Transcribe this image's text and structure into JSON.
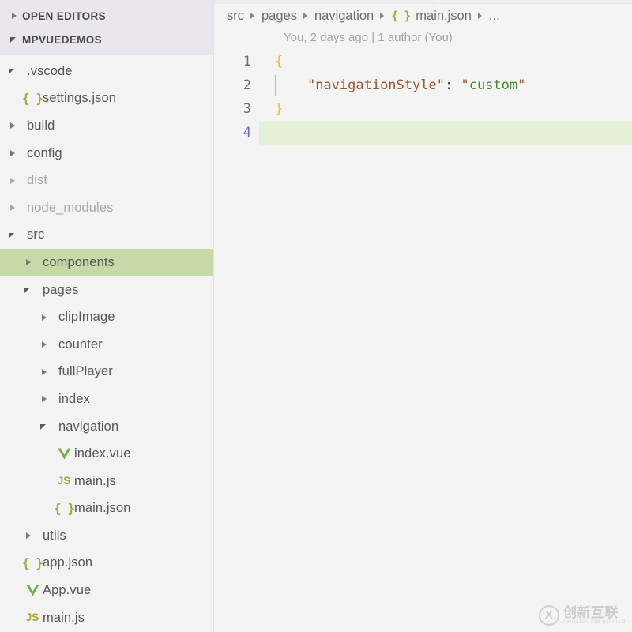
{
  "sidebar": {
    "panels": [
      {
        "label": "OPEN EDITORS",
        "state": "collapsed",
        "icon": "chevron-right-icon"
      },
      {
        "label": "MPVUEDEMOS",
        "state": "expanded",
        "icon": "chevron-down-icon"
      }
    ],
    "tree": [
      {
        "label": ".vscode",
        "indent": 1,
        "state": "expanded",
        "icon": "folder-twisty",
        "dim": false,
        "selected": false
      },
      {
        "label": "settings.json",
        "indent": 2,
        "state": "file",
        "icon": "json-icon",
        "dim": false,
        "selected": false
      },
      {
        "label": "build",
        "indent": 1,
        "state": "collapsed",
        "icon": "folder-twisty",
        "dim": false,
        "selected": false
      },
      {
        "label": "config",
        "indent": 1,
        "state": "collapsed",
        "icon": "folder-twisty",
        "dim": false,
        "selected": false
      },
      {
        "label": "dist",
        "indent": 1,
        "state": "collapsed",
        "icon": "folder-twisty",
        "dim": true,
        "selected": false
      },
      {
        "label": "node_modules",
        "indent": 1,
        "state": "collapsed",
        "icon": "folder-twisty",
        "dim": true,
        "selected": false
      },
      {
        "label": "src",
        "indent": 1,
        "state": "expanded",
        "icon": "folder-twisty",
        "dim": false,
        "selected": false
      },
      {
        "label": "components",
        "indent": 2,
        "state": "collapsed",
        "icon": "folder-twisty",
        "dim": false,
        "selected": true
      },
      {
        "label": "pages",
        "indent": 2,
        "state": "expanded",
        "icon": "folder-twisty",
        "dim": false,
        "selected": false
      },
      {
        "label": "clipImage",
        "indent": 3,
        "state": "collapsed",
        "icon": "folder-twisty",
        "dim": false,
        "selected": false
      },
      {
        "label": "counter",
        "indent": 3,
        "state": "collapsed",
        "icon": "folder-twisty",
        "dim": false,
        "selected": false
      },
      {
        "label": "fullPlayer",
        "indent": 3,
        "state": "collapsed",
        "icon": "folder-twisty",
        "dim": false,
        "selected": false
      },
      {
        "label": "index",
        "indent": 3,
        "state": "collapsed",
        "icon": "folder-twisty",
        "dim": false,
        "selected": false
      },
      {
        "label": "navigation",
        "indent": 3,
        "state": "expanded",
        "icon": "folder-twisty",
        "dim": false,
        "selected": false
      },
      {
        "label": "index.vue",
        "indent": 4,
        "state": "file",
        "icon": "vue-icon",
        "dim": false,
        "selected": false
      },
      {
        "label": "main.js",
        "indent": 4,
        "state": "file",
        "icon": "js-icon",
        "dim": false,
        "selected": false
      },
      {
        "label": "main.json",
        "indent": 4,
        "state": "file",
        "icon": "json-icon",
        "dim": false,
        "selected": false
      },
      {
        "label": "utils",
        "indent": 2,
        "state": "collapsed",
        "icon": "folder-twisty",
        "dim": false,
        "selected": false
      },
      {
        "label": "app.json",
        "indent": 2,
        "state": "file",
        "icon": "json-icon",
        "dim": false,
        "selected": false
      },
      {
        "label": "App.vue",
        "indent": 2,
        "state": "file",
        "icon": "vue-icon",
        "dim": false,
        "selected": false
      },
      {
        "label": "main.js",
        "indent": 2,
        "state": "file",
        "icon": "js-icon",
        "dim": false,
        "selected": false
      }
    ]
  },
  "editor": {
    "breadcrumb": [
      {
        "label": "src",
        "icon": null
      },
      {
        "label": "pages",
        "icon": null
      },
      {
        "label": "navigation",
        "icon": null
      },
      {
        "label": "main.json",
        "icon": "json-icon"
      },
      {
        "label": "...",
        "icon": null
      }
    ],
    "blame": "You, 2 days ago | 1 author (You)",
    "lines": [
      {
        "number": "1",
        "active": false,
        "indent_guide": false,
        "tokens": [
          {
            "t": "{",
            "c": "tok-brace"
          }
        ]
      },
      {
        "number": "2",
        "active": false,
        "indent_guide": true,
        "tokens": [
          {
            "t": "    ",
            "c": "tok-punc"
          },
          {
            "t": "\"navigationStyle\"",
            "c": "tok-key"
          },
          {
            "t": ":",
            "c": "tok-punc"
          },
          {
            "t": " ",
            "c": "tok-punc"
          },
          {
            "t": "\"",
            "c": "tok-quote"
          },
          {
            "t": "custom",
            "c": "tok-str"
          },
          {
            "t": "\"",
            "c": "tok-quote"
          }
        ]
      },
      {
        "number": "3",
        "active": false,
        "indent_guide": false,
        "tokens": [
          {
            "t": "}",
            "c": "tok-brace"
          }
        ]
      },
      {
        "number": "4",
        "active": true,
        "indent_guide": false,
        "tokens": [
          {
            "t": "",
            "c": "tok-punc"
          }
        ]
      }
    ]
  },
  "watermark": {
    "mark": "X",
    "chinese": "创新互联",
    "pinyin": "CHUANG XIN HU LIAN"
  },
  "colors": {
    "selection_green": "#c7d9a7",
    "current_line_green": "#e6f2d6",
    "panel_header_bg": "#e9e6f0",
    "sidebar_bg": "#f3f3f3",
    "editor_bg": "#f4f4f4",
    "icon_olive": "#a9a732",
    "icon_vue_green": "#6fae4a",
    "active_line_number": "#7a5cd6",
    "string_green": "#448c27",
    "key_brown": "#a0522d",
    "brace_yellow": "#e8bf3c"
  }
}
